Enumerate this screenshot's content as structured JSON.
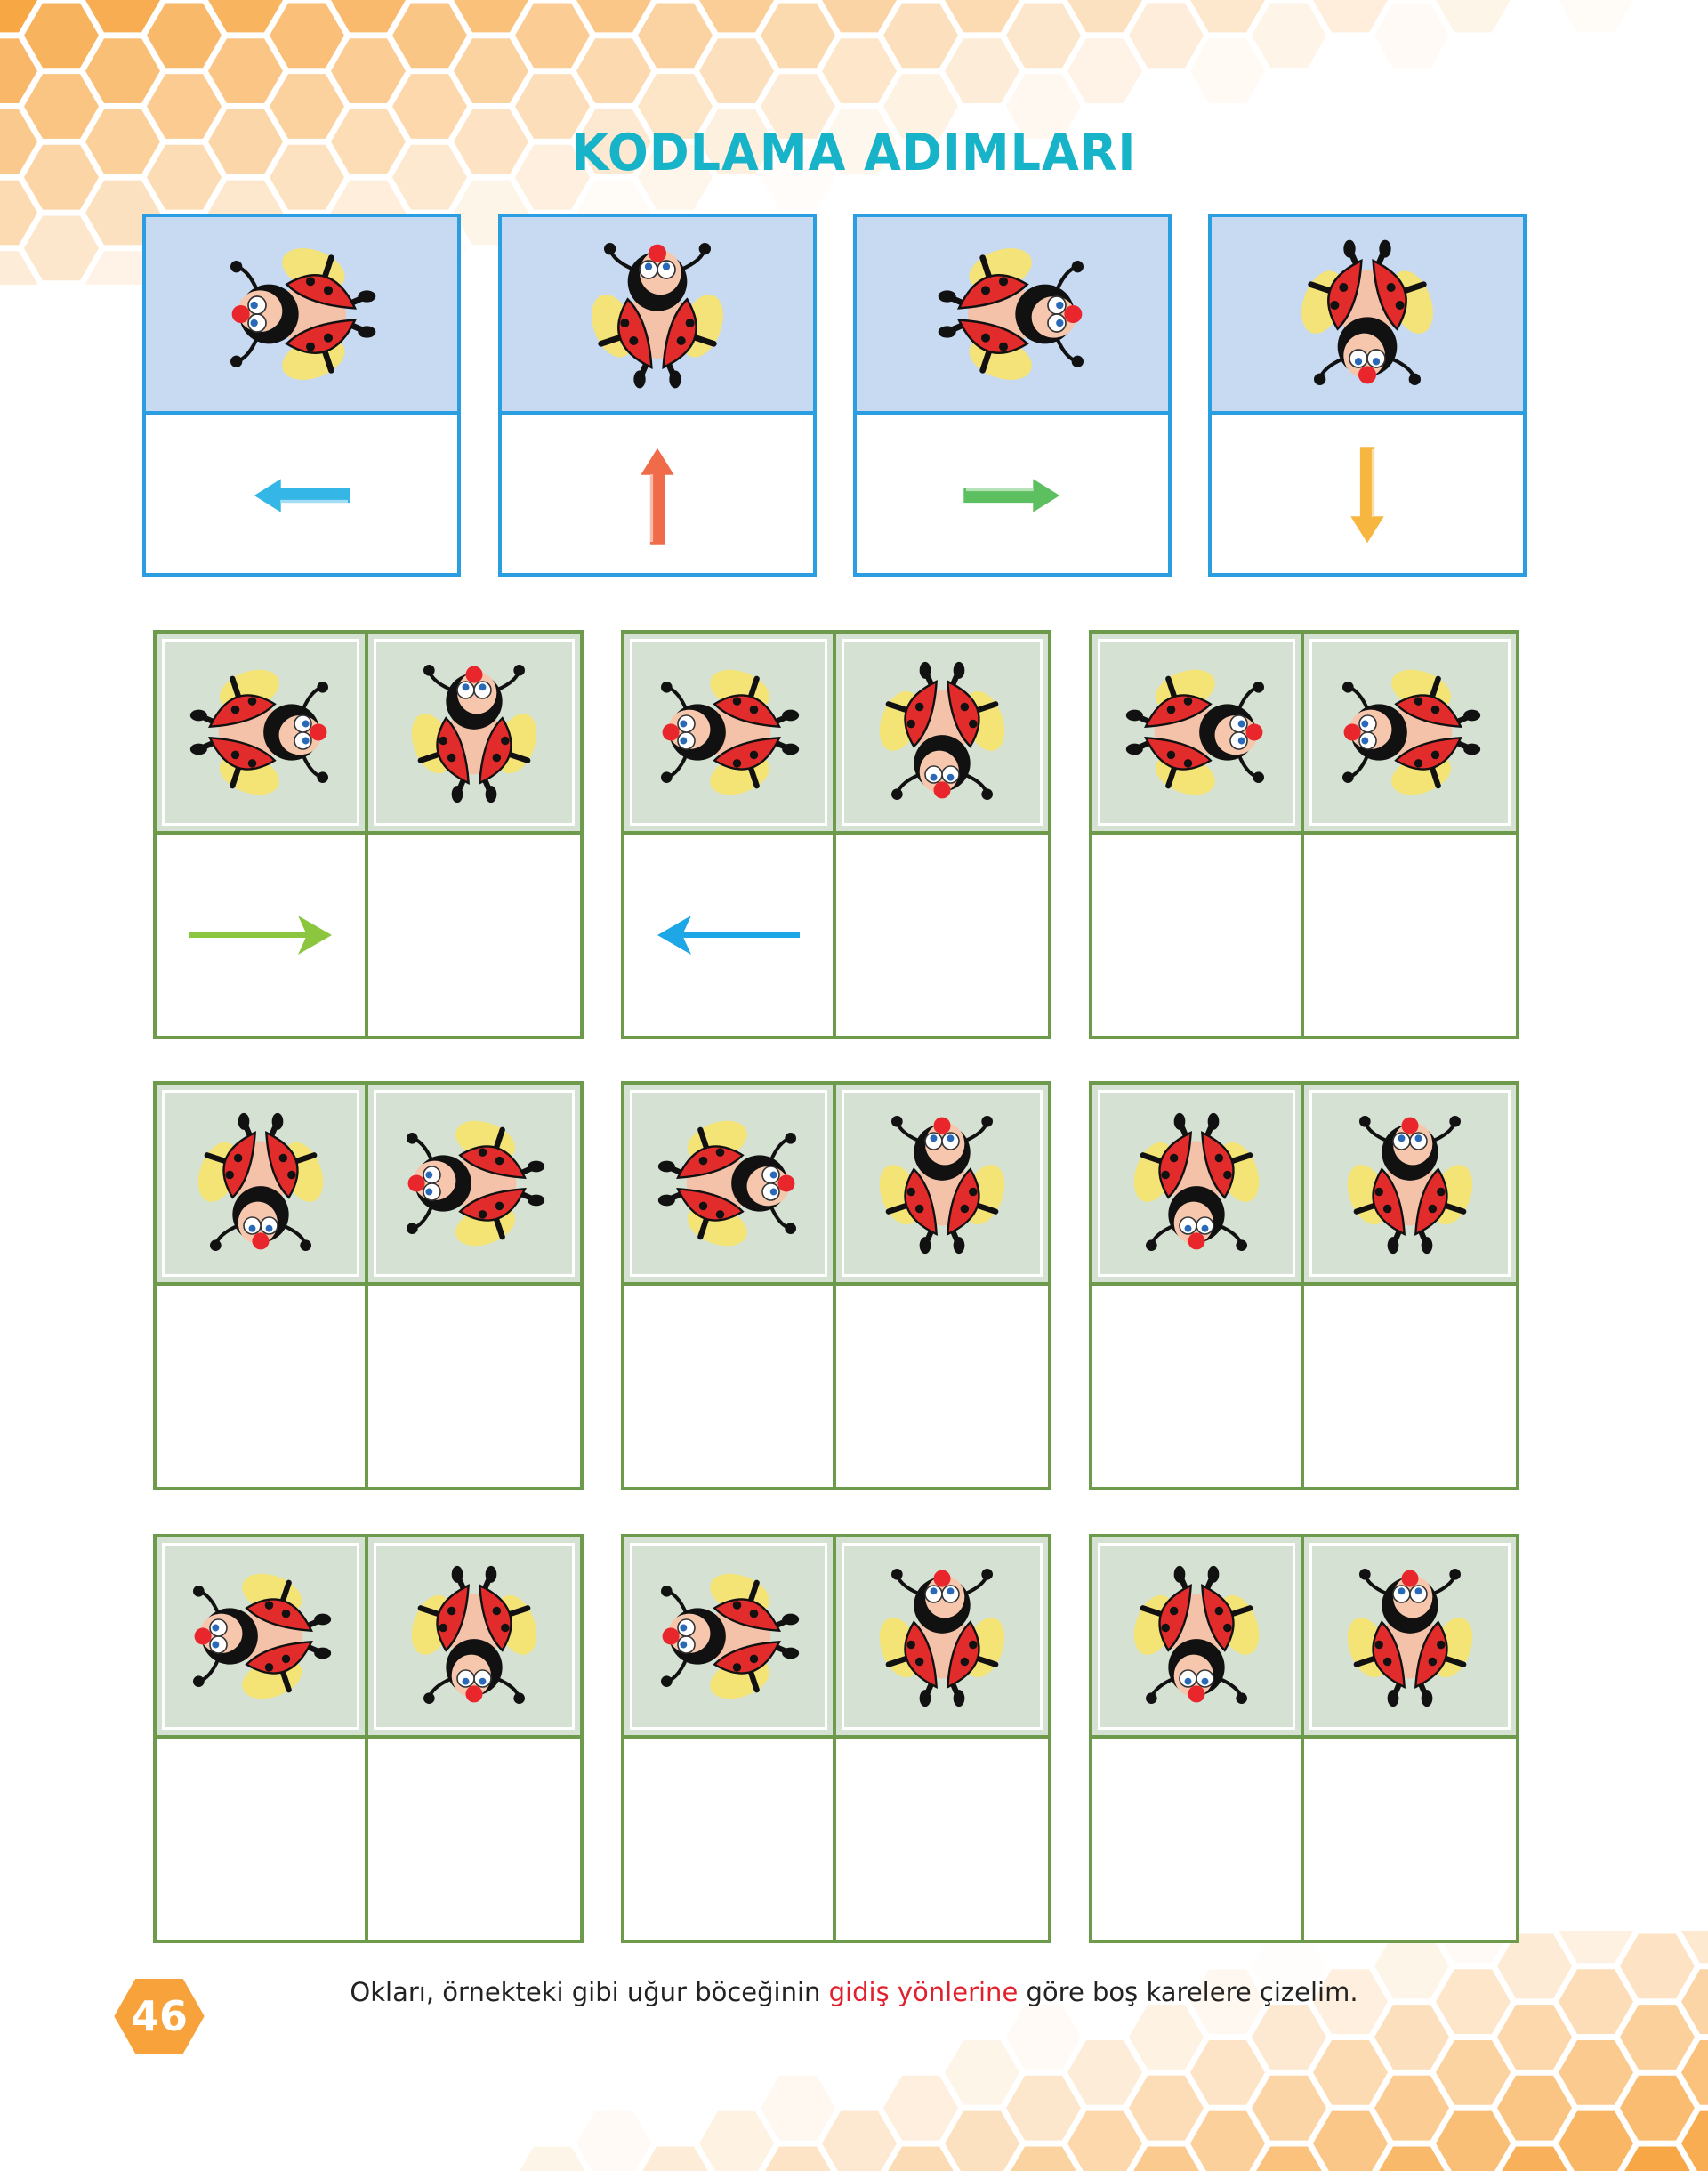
{
  "title": "KODLAMA ADIMLARI",
  "colors": {
    "title": "#17b3c8",
    "legend_border": "#2a9ee0",
    "legend_bg": "#c8daf2",
    "puzzle_border": "#6e9a4b",
    "puzzle_bg": "#d5e2d3",
    "highlight": "#e0202d",
    "honeycomb": "#f7a23a"
  },
  "legend": [
    {
      "direction": "left",
      "arrow_icon": "left-arrow-icon",
      "arrow_color": "#34b6e6"
    },
    {
      "direction": "up",
      "arrow_icon": "up-arrow-icon",
      "arrow_color": "#f06b4a"
    },
    {
      "direction": "right",
      "arrow_icon": "right-arrow-icon",
      "arrow_color": "#5cbf60"
    },
    {
      "direction": "down",
      "arrow_icon": "down-arrow-icon",
      "arrow_color": "#f6b640"
    }
  ],
  "puzzles": [
    {
      "bugs": [
        "right",
        "up"
      ],
      "answers": [
        "right",
        null
      ]
    },
    {
      "bugs": [
        "left",
        "down"
      ],
      "answers": [
        "left",
        null
      ]
    },
    {
      "bugs": [
        "right",
        "left"
      ],
      "answers": [
        null,
        null
      ]
    },
    {
      "bugs": [
        "down",
        "left"
      ],
      "answers": [
        null,
        null
      ]
    },
    {
      "bugs": [
        "right",
        "up"
      ],
      "answers": [
        null,
        null
      ]
    },
    {
      "bugs": [
        "down",
        "up"
      ],
      "answers": [
        null,
        null
      ]
    },
    {
      "bugs": [
        "left",
        "down"
      ],
      "answers": [
        null,
        null
      ]
    },
    {
      "bugs": [
        "left",
        "up"
      ],
      "answers": [
        null,
        null
      ]
    },
    {
      "bugs": [
        "down",
        "up"
      ],
      "answers": [
        null,
        null
      ]
    }
  ],
  "instruction": {
    "before": "Okları, örnekteki gibi uğur böceğinin ",
    "highlight": "gidiş yönlerine",
    "after": " göre boş karelere çizelim."
  },
  "page_number": "46"
}
